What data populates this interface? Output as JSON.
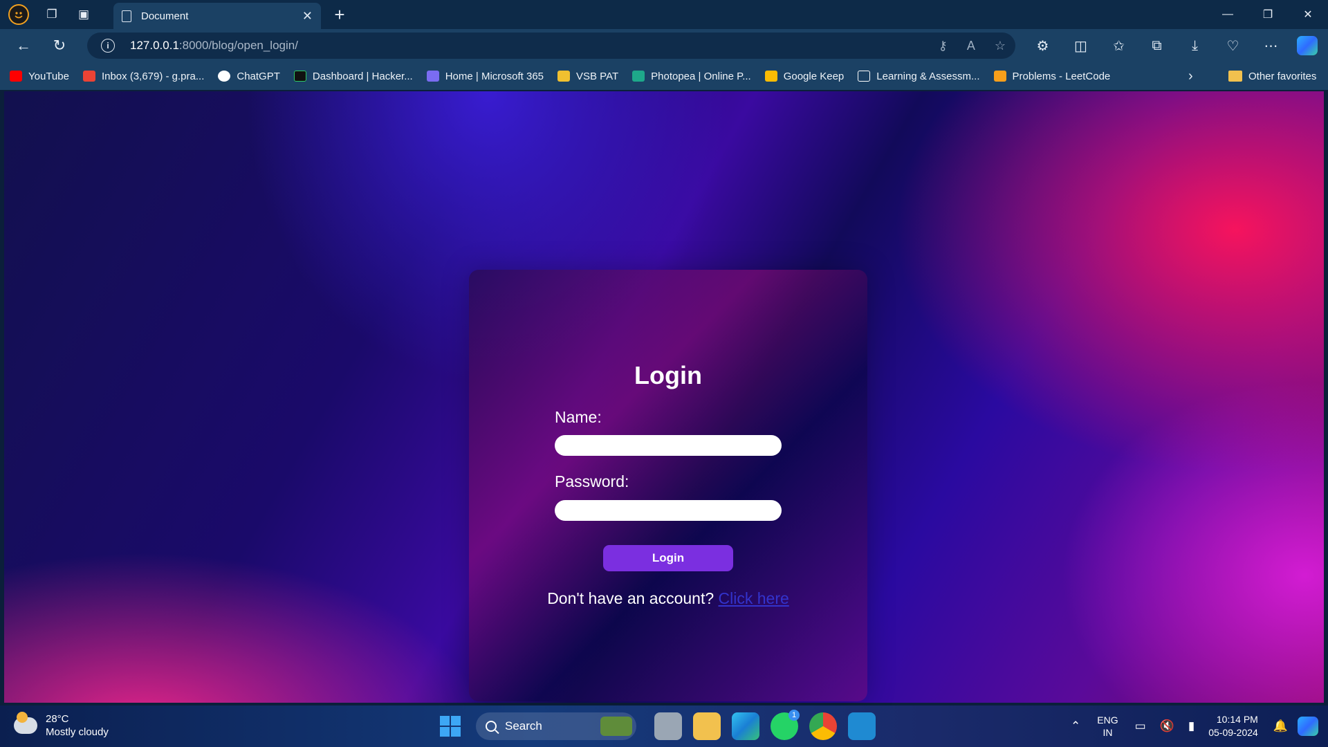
{
  "browser": {
    "tab_title": "Document",
    "url_host": "127.0.0.1",
    "url_path": ":8000/blog/open_login/",
    "bookmarks": [
      {
        "label": "YouTube",
        "color": "#ff0000"
      },
      {
        "label": "Inbox (3,679) - g.pra...",
        "color": "#ea4335"
      },
      {
        "label": "ChatGPT",
        "color": "#ffffff"
      },
      {
        "label": "Dashboard | Hacker...",
        "color": "#111111"
      },
      {
        "label": "Home | Microsoft 365",
        "color": "#7a6cf2"
      },
      {
        "label": "VSB PAT",
        "color": "#f0c030"
      },
      {
        "label": "Photopea | Online P...",
        "color": "#1ea88a"
      },
      {
        "label": "Google Keep",
        "color": "#fbbc04"
      },
      {
        "label": "Learning & Assessm...",
        "color": "#ffffff"
      },
      {
        "label": "Problems - LeetCode",
        "color": "#f89f1b"
      }
    ],
    "other_favorites": "Other favorites"
  },
  "login": {
    "title": "Login",
    "name_label": "Name:",
    "password_label": "Password:",
    "button_label": "Login",
    "signup_text": "Don't have an account?",
    "signup_link": "Click here"
  },
  "taskbar": {
    "temperature": "28°C",
    "weather": "Mostly cloudy",
    "search_placeholder": "Search",
    "whatsapp_badge": "1",
    "lang_top": "ENG",
    "lang_bottom": "IN",
    "time": "10:14 PM",
    "date": "05-09-2024"
  },
  "colors": {
    "accent_button": "#7b2fe0",
    "link": "#3333cc"
  }
}
